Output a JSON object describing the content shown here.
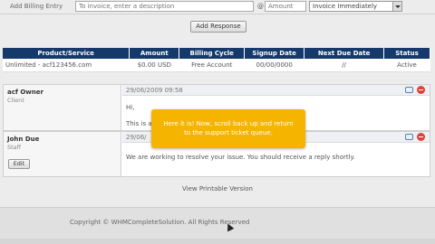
{
  "billing": {
    "label": "Add Billing Entry",
    "description_placeholder": "To invoice, enter a description",
    "at": "@",
    "amount_placeholder": "Amount",
    "invoice_option": "Invoice Immediately",
    "add_response_label": "Add Response"
  },
  "products": {
    "headers": [
      "Product/Service",
      "Amount",
      "Billing Cycle",
      "Signup Date",
      "Next Due Date",
      "Status"
    ],
    "rows": [
      [
        "Unlimited - acf123456.com",
        "$0.00 USD",
        "Free Account",
        "00/00/0000",
        "//",
        "Active"
      ]
    ]
  },
  "replies": [
    {
      "name": "acf Owner",
      "role": "Client",
      "date": "29/06/2009 09:58",
      "lines": [
        "Hi,",
        "This is a"
      ]
    },
    {
      "name": "John Due",
      "role": "Staff",
      "date": "29/06/",
      "edit_label": "Edit",
      "lines": [
        "We are working to resolve your issue. You should receive a reply shortly."
      ]
    }
  ],
  "tooltip": {
    "line1": "Here it is! Now, scroll back up and return",
    "line2": "to the support ticket queue."
  },
  "printable_label": "View Printable Version",
  "copyright": "Copyright © WHMCompleteSolution. All Rights Reserved",
  "colors": {
    "table_header": "#16396b",
    "tooltip": "#f5b400",
    "delete": "#e0413b"
  }
}
